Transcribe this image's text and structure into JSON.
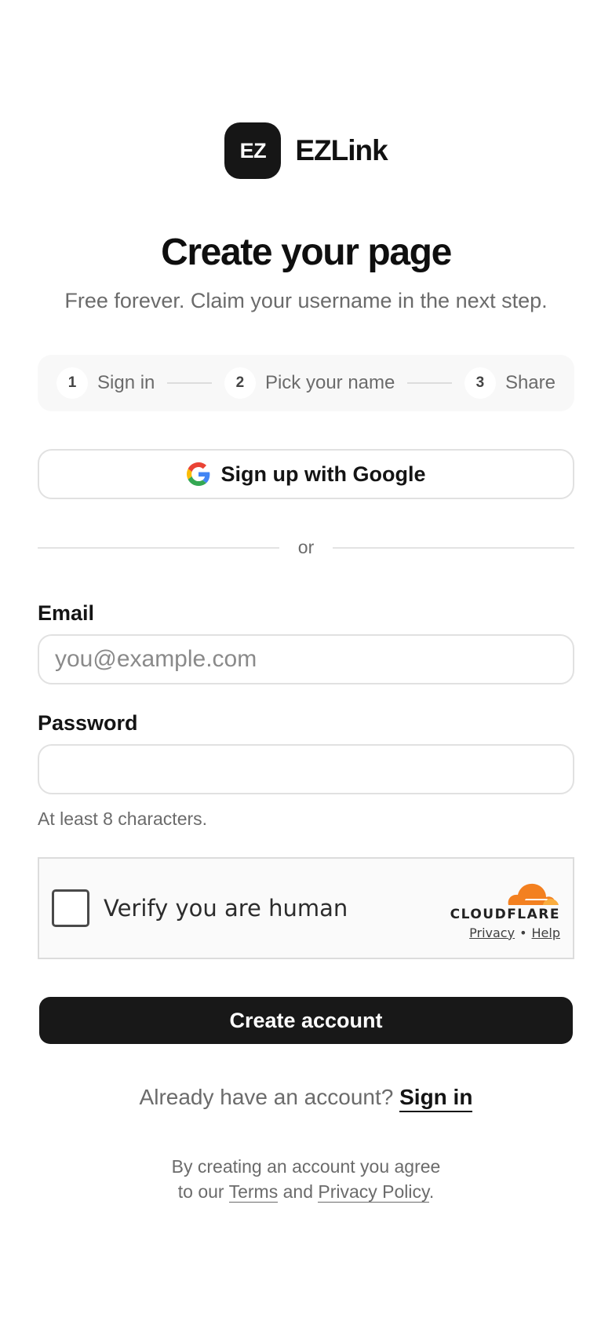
{
  "brand": {
    "logo_text": "EZ",
    "name": "EZLink"
  },
  "header": {
    "title": "Create your page",
    "subtitle": "Free forever. Claim your username in the next step."
  },
  "steps": [
    {
      "number": "1",
      "label": "Sign in"
    },
    {
      "number": "2",
      "label": "Pick your name"
    },
    {
      "number": "3",
      "label": "Share"
    }
  ],
  "google_button": {
    "label": "Sign up with Google",
    "icon": "google-g-icon"
  },
  "divider": {
    "text": "or"
  },
  "form": {
    "email_label": "Email",
    "email_placeholder": "you@example.com",
    "email_value": "",
    "password_label": "Password",
    "password_value": "",
    "password_hint": "At least 8 characters."
  },
  "captcha": {
    "text": "Verify you are human",
    "brand": "CLOUDFLARE",
    "privacy_link": "Privacy",
    "separator": "•",
    "help_link": "Help",
    "brand_color": "#F38020"
  },
  "submit": {
    "label": "Create account"
  },
  "signin": {
    "prompt": "Already have an account?",
    "link": "Sign in"
  },
  "legal": {
    "line1": "By creating an account you agree",
    "prefix": "to our",
    "terms": "Terms",
    "and": "and",
    "privacy": "Privacy Policy",
    "suffix": "."
  },
  "colors": {
    "primary": "#181818",
    "muted_text": "#6B6B6B",
    "border": "#E1E1E1",
    "steps_background": "#F8F8F8"
  }
}
